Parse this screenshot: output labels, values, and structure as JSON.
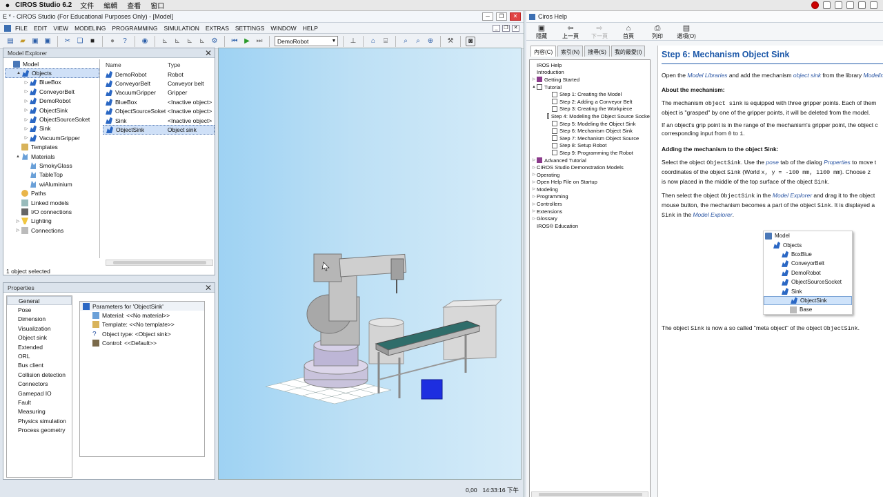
{
  "macbar": {
    "app": "CIROS Studio 6.2",
    "menus": [
      "文件",
      "編輯",
      "查看",
      "窗口"
    ]
  },
  "ciros": {
    "title": "E * - CIROS Studio (For Educational Purposes Only) - [Model]",
    "menus": [
      "FILE",
      "EDIT",
      "VIEW",
      "MODELING",
      "PROGRAMMING",
      "SIMULATION",
      "EXTRAS",
      "SETTINGS",
      "WINDOW",
      "HELP"
    ],
    "robot_select": "DemoRobot",
    "model_explorer": {
      "title": "Model Explorer",
      "tree": [
        {
          "label": "Model",
          "level": 0,
          "icon": "model",
          "expander": ""
        },
        {
          "label": "Objects",
          "level": 1,
          "icon": "obj",
          "expander": "▲",
          "selected": true
        },
        {
          "label": "BlueBox",
          "level": 2,
          "icon": "obj",
          "expander": "▷"
        },
        {
          "label": "ConveyorBelt",
          "level": 2,
          "icon": "obj",
          "expander": "▷"
        },
        {
          "label": "DemoRobot",
          "level": 2,
          "icon": "obj",
          "expander": "▷"
        },
        {
          "label": "ObjectSink",
          "level": 2,
          "icon": "obj",
          "expander": "▷"
        },
        {
          "label": "ObjectSourceSoket",
          "level": 2,
          "icon": "obj",
          "expander": "▷"
        },
        {
          "label": "Sink",
          "level": 2,
          "icon": "obj",
          "expander": "▷"
        },
        {
          "label": "VacuumGripper",
          "level": 2,
          "icon": "obj",
          "expander": "▷"
        },
        {
          "label": "Templates",
          "level": 1,
          "icon": "folder",
          "expander": ""
        },
        {
          "label": "Materials",
          "level": 1,
          "icon": "mat",
          "expander": "▲"
        },
        {
          "label": "SmokyGlass",
          "level": 2,
          "icon": "mat",
          "expander": ""
        },
        {
          "label": "TableTop",
          "level": 2,
          "icon": "mat",
          "expander": ""
        },
        {
          "label": "wiAluminium",
          "level": 2,
          "icon": "mat",
          "expander": ""
        },
        {
          "label": "Paths",
          "level": 1,
          "icon": "path",
          "expander": ""
        },
        {
          "label": "Linked models",
          "level": 1,
          "icon": "link",
          "expander": ""
        },
        {
          "label": "I/O connections",
          "level": 1,
          "icon": "io",
          "expander": ""
        },
        {
          "label": "Lighting",
          "level": 1,
          "icon": "light",
          "expander": "▷"
        },
        {
          "label": "Connections",
          "level": 1,
          "icon": "conn",
          "expander": "▷"
        }
      ],
      "columns": [
        "Name",
        "Type"
      ],
      "rows": [
        {
          "name": "DemoRobot",
          "type": "Robot"
        },
        {
          "name": "ConveyorBelt",
          "type": "Conveyor belt"
        },
        {
          "name": "VacuumGripper",
          "type": "Gripper"
        },
        {
          "name": "BlueBox",
          "type": "<Inactive object>"
        },
        {
          "name": "ObjectSourceSoket",
          "type": "<Inactive object>"
        },
        {
          "name": "Sink",
          "type": "<Inactive object>"
        },
        {
          "name": "ObjectSink",
          "type": "Object sink",
          "selected": true
        }
      ],
      "status": "1 object selected"
    },
    "properties": {
      "title": "Properties",
      "categories": [
        "General",
        "Pose",
        "Dimension",
        "Visualization",
        "Object sink",
        "Extended",
        "ORL",
        "Bus client",
        "Collision detection",
        "Connectors",
        "Gamepad IO",
        "Fault",
        "Measuring",
        "Physics simulation",
        "Process geometry"
      ],
      "header": "Parameters for 'ObjectSink'",
      "params": [
        "Material: <<No material>>",
        "Template: <<No template>>",
        "Object type: <Object sink>",
        "Control: <<Default>>"
      ]
    },
    "statusbar": {
      "coords": "0,00",
      "time": "14:33:16 下午"
    }
  },
  "help": {
    "title": "Ciros Help",
    "toolbar": [
      {
        "label": "隱藏",
        "glyph": "▣",
        "dim": false
      },
      {
        "label": "上一頁",
        "glyph": "⇦",
        "dim": false
      },
      {
        "label": "下一頁",
        "glyph": "⇨",
        "dim": true
      },
      {
        "label": "首頁",
        "glyph": "⌂",
        "dim": false
      },
      {
        "label": "列印",
        "glyph": "⎙",
        "dim": false
      },
      {
        "label": "選項(O)",
        "glyph": "▤",
        "dim": false
      }
    ],
    "tabs": [
      "內容(C)",
      "索引(N)",
      "搜尋(S)",
      "我的最愛(I)"
    ],
    "toc": [
      {
        "label": "IROS Help",
        "indent": 0,
        "icon": "",
        "tri": ""
      },
      {
        "label": "Introduction",
        "indent": 0,
        "icon": "",
        "tri": ""
      },
      {
        "label": "Getting Started",
        "indent": 0,
        "icon": "book",
        "tri": "▷"
      },
      {
        "label": "Tutorial",
        "indent": 0,
        "icon": "bookopen",
        "tri": "▲"
      },
      {
        "label": "Step 1: Creating the Model",
        "indent": 1,
        "icon": "page",
        "tri": ""
      },
      {
        "label": "Step 2: Adding a Conveyor Belt",
        "indent": 1,
        "icon": "page",
        "tri": ""
      },
      {
        "label": "Step 3: Creating the Workpiece",
        "indent": 1,
        "icon": "page",
        "tri": ""
      },
      {
        "label": "Step 4: Modeling the Object Source Socke",
        "indent": 1,
        "icon": "page",
        "tri": ""
      },
      {
        "label": "Step 5: Modeling the Object Sink",
        "indent": 1,
        "icon": "page",
        "tri": ""
      },
      {
        "label": "Step 6: Mechanism Object Sink",
        "indent": 1,
        "icon": "page",
        "tri": ""
      },
      {
        "label": "Step 7: Mechanism Object Source",
        "indent": 1,
        "icon": "page",
        "tri": ""
      },
      {
        "label": "Step 8: Setup Robot",
        "indent": 1,
        "icon": "page",
        "tri": ""
      },
      {
        "label": "Step 9: Programming the Robot",
        "indent": 1,
        "icon": "page",
        "tri": ""
      },
      {
        "label": "Advanced Tutorial",
        "indent": 0,
        "icon": "book",
        "tri": "▷"
      },
      {
        "label": "CIROS Studio Demonstration Models",
        "indent": 0,
        "icon": "",
        "tri": "▷"
      },
      {
        "label": "Operating",
        "indent": 0,
        "icon": "",
        "tri": "▷"
      },
      {
        "label": "Open Help File on Startup",
        "indent": 0,
        "icon": "",
        "tri": "▷"
      },
      {
        "label": "Modeling",
        "indent": 0,
        "icon": "",
        "tri": "▷"
      },
      {
        "label": "Programming",
        "indent": 0,
        "icon": "",
        "tri": "▷"
      },
      {
        "label": "Controllers",
        "indent": 0,
        "icon": "",
        "tri": "▷"
      },
      {
        "label": "Extensions",
        "indent": 0,
        "icon": "",
        "tri": "▷"
      },
      {
        "label": "Glossary",
        "indent": 0,
        "icon": "",
        "tri": "▷"
      },
      {
        "label": "IROS® Education",
        "indent": 0,
        "icon": "",
        "tri": ""
      }
    ],
    "article": {
      "heading": "Step 6: Mechanism Object Sink",
      "p1_a": "Open the ",
      "p1_link1": "Model Libraries",
      "p1_b": " and add the mechanism ",
      "p1_link2": "object sink",
      "p1_c": " from the library ",
      "p1_link3": "Modeling",
      "h_about": "About the mechanism:",
      "p2_a": "The mechanism ",
      "p2_code": "object sink",
      "p2_b": " is equipped with three gripper points. Each of them",
      "p2_line2": "object is \"grasped\" by one of the gripper points, it will be deleted from the model.",
      "p3_line1": "If an object's grip point is in the range of the mechanism's gripper point, the object c",
      "p3_a": "corresponding input from ",
      "p3_c0": "0",
      "p3_b": " to ",
      "p3_c1": "1",
      "p3_end": ".",
      "h_adding": "Adding the mechanism to the object Sink:",
      "p4_a": "Select the object ",
      "p4_c1": "ObjectSink",
      "p4_b": ". Use the ",
      "p4_l1": "pose",
      "p4_c": " tab of the dialog ",
      "p4_l2": "Properties",
      "p4_d": " to move t",
      "p4_line2a": "coordinates of the object ",
      "p4_c2": "Sink",
      "p4_line2b": " (World ",
      "p4_c3": "x, y = -100 mm, 1100 mm",
      "p4_line2c": "). Choose ",
      "p4_c4": "z",
      "p4_line3a": "is now placed in the middle of the top surface of the object ",
      "p4_c5": "Sink",
      "p4_line3b": ".",
      "p5_a": "Then select the object ",
      "p5_c1": "ObjectSink",
      "p5_b": " in the ",
      "p5_l1": "Model Explorer",
      "p5_c": " and drag it to the object ",
      "p5_line2a": "mouse button, the mechanism  becomes a part of the object ",
      "p5_c2": "Sink",
      "p5_line2b": ". It is displayed a",
      "p5_line3a": "Sink",
      "p5_line3b": " in the ",
      "p5_l2": "Model Explorer",
      "p5_line3c": ".",
      "figure": [
        "Model",
        "Objects",
        "BoxBlue",
        "ConveyorBelt",
        "DemoRobot",
        "ObjectSourceSocket",
        "Sink",
        "ObjectSink",
        "Base"
      ],
      "p6_a": "The object ",
      "p6_c1": "Sink",
      "p6_b": " is now a so called \"meta object\" of the object ",
      "p6_c2": "ObjectSink",
      "p6_end": "."
    }
  }
}
